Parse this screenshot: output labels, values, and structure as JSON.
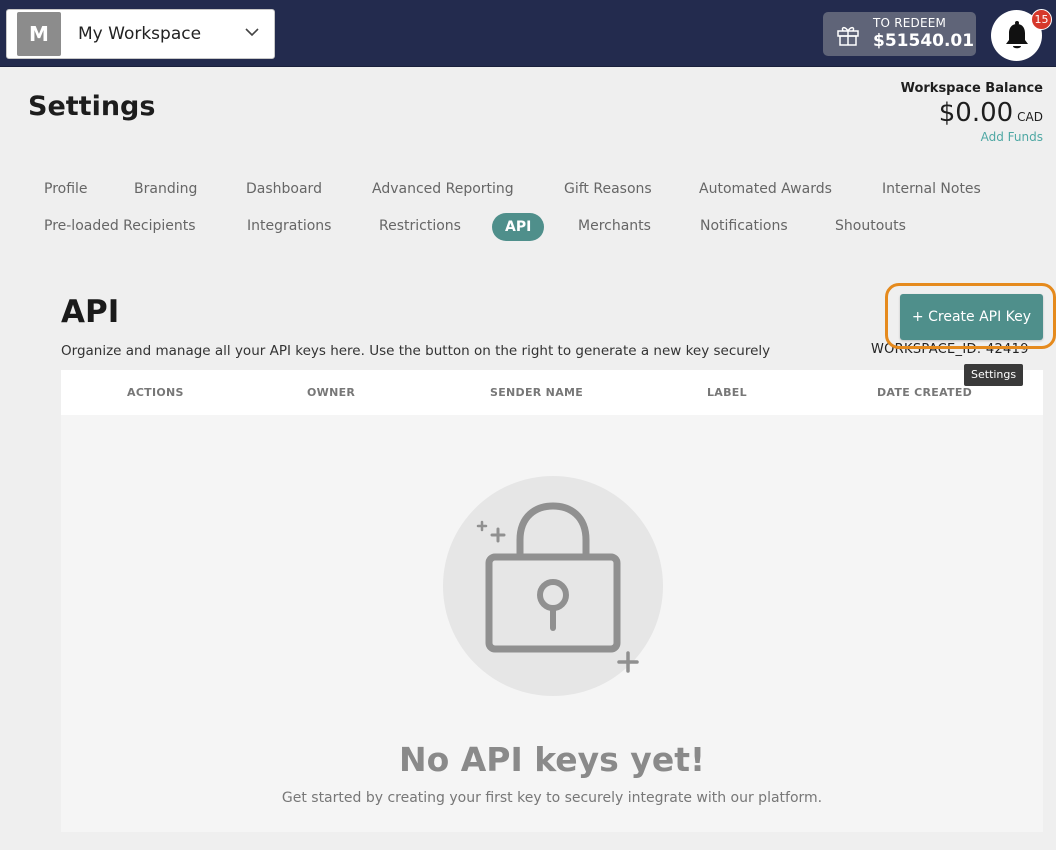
{
  "workspace": {
    "initial": "M",
    "name": "My Workspace"
  },
  "redeem": {
    "label": "TO REDEEM",
    "amount": "$51540.01"
  },
  "notifications": {
    "count": "15"
  },
  "header": {
    "title": "Settings",
    "balance_label": "Workspace Balance",
    "balance_amount": "$0.00",
    "currency": "CAD",
    "add_funds": "Add Funds"
  },
  "tabs": [
    {
      "label": "Profile"
    },
    {
      "label": "Branding"
    },
    {
      "label": "Dashboard"
    },
    {
      "label": "Advanced Reporting"
    },
    {
      "label": "Gift Reasons"
    },
    {
      "label": "Automated Awards"
    },
    {
      "label": "Internal Notes"
    },
    {
      "label": "Pre-loaded Recipients"
    },
    {
      "label": "Integrations"
    },
    {
      "label": "Restrictions"
    },
    {
      "label": "API",
      "active": true
    },
    {
      "label": "Merchants"
    },
    {
      "label": "Notifications"
    },
    {
      "label": "Shoutouts"
    }
  ],
  "api": {
    "title": "API",
    "description": "Organize and manage all your API keys here. Use the button on the right to generate a new key securely",
    "workspace_id": "WORKSPACE_ID: 42419",
    "create_button": "+ Create API Key",
    "tooltip": "Settings",
    "columns": [
      "ACTIONS",
      "OWNER",
      "SENDER NAME",
      "LABEL",
      "DATE CREATED"
    ],
    "empty_title": "No API keys yet!",
    "empty_subtitle": "Get started by creating your first key to securely integrate with our platform."
  },
  "colors": {
    "topbar": "#232b4e",
    "accent": "#4f8f8b",
    "highlight": "#e58a1d",
    "badge": "#d6382b"
  }
}
